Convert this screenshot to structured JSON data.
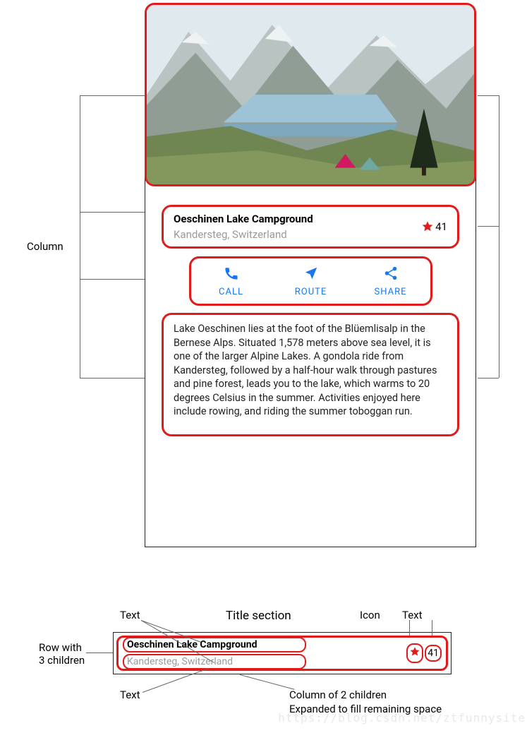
{
  "main": {
    "title": "Oeschinen Lake Campground",
    "location": "Kandersteg, Switzerland",
    "rating": "41",
    "actions": {
      "call": "CALL",
      "route": "ROUTE",
      "share": "SHARE"
    },
    "description": "Lake Oeschinen lies at the foot of the Blüemlisalp in the Bernese Alps. Situated 1,578 meters above sea level, it is one of the larger Alpine Lakes. A gondola ride from Kandersteg, followed by a half-hour walk through pastures and pine forest, leads you to the lake, which warms to 20 degrees Celsius in the summer. Activities enjoyed here include rowing, and riding the summer toboggan run."
  },
  "detail": {
    "heading": "Title section",
    "title": "Oeschinen Lake Campground",
    "location": "Kandersteg, Switzerland",
    "rating": "41"
  },
  "annotations": {
    "column": "Column",
    "text1": "Text",
    "text2": "Text",
    "icon": "Icon",
    "text3": "Text",
    "row_with": "Row with",
    "three_children": "3 children",
    "column_of_2": "Column of 2 children",
    "expanded": "Expanded to fill remaining space"
  },
  "colors": {
    "accent_red": "#e11b1b",
    "link_blue": "#1976f2",
    "muted": "#9a9a9a"
  },
  "watermark": "https://blog.csdn.net/ztfunnysite"
}
